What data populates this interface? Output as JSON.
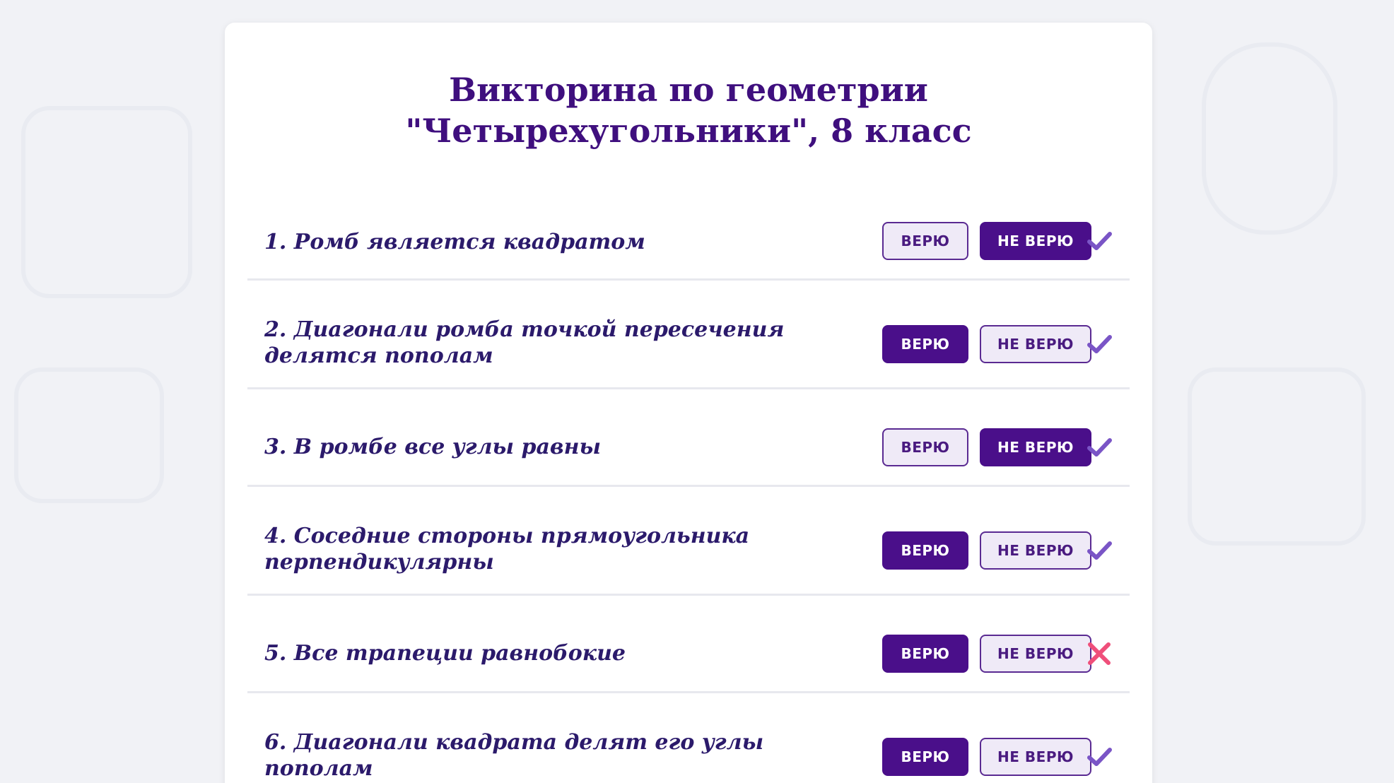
{
  "quiz": {
    "title_line1": "Викторина по геометрии",
    "title_line2": "\"Четырехугольники\", 8 класс",
    "button_labels": {
      "believe": "ВЕРЮ",
      "not_believe": "НЕ ВЕРЮ"
    },
    "questions": [
      {
        "text": "1. Ромб является квадратом",
        "selected": "not_believe",
        "result": "correct",
        "result_icon": "check-icon"
      },
      {
        "text": "2. Диагонали ромба точкой пересечения делятся пополам",
        "selected": "believe",
        "result": "correct",
        "result_icon": "check-icon"
      },
      {
        "text": "3. В ромбе все углы равны",
        "selected": "not_believe",
        "result": "correct",
        "result_icon": "check-icon"
      },
      {
        "text": "4. Соседние стороны прямоугольника перпендикулярны",
        "selected": "believe",
        "result": "correct",
        "result_icon": "check-icon"
      },
      {
        "text": "5. Все трапеции равнобокие",
        "selected": "believe",
        "result": "incorrect",
        "result_icon": "cross-icon"
      },
      {
        "text": "6. Диагонали квадрата делят его углы пополам",
        "selected": "believe",
        "result": "correct",
        "result_icon": "check-icon"
      }
    ],
    "colors": {
      "accent": "#4a0f8a",
      "title": "#3f0f7e",
      "question_text": "#2b1a6b",
      "check": "#7a55c6",
      "cross": "#ef4f7a"
    }
  }
}
